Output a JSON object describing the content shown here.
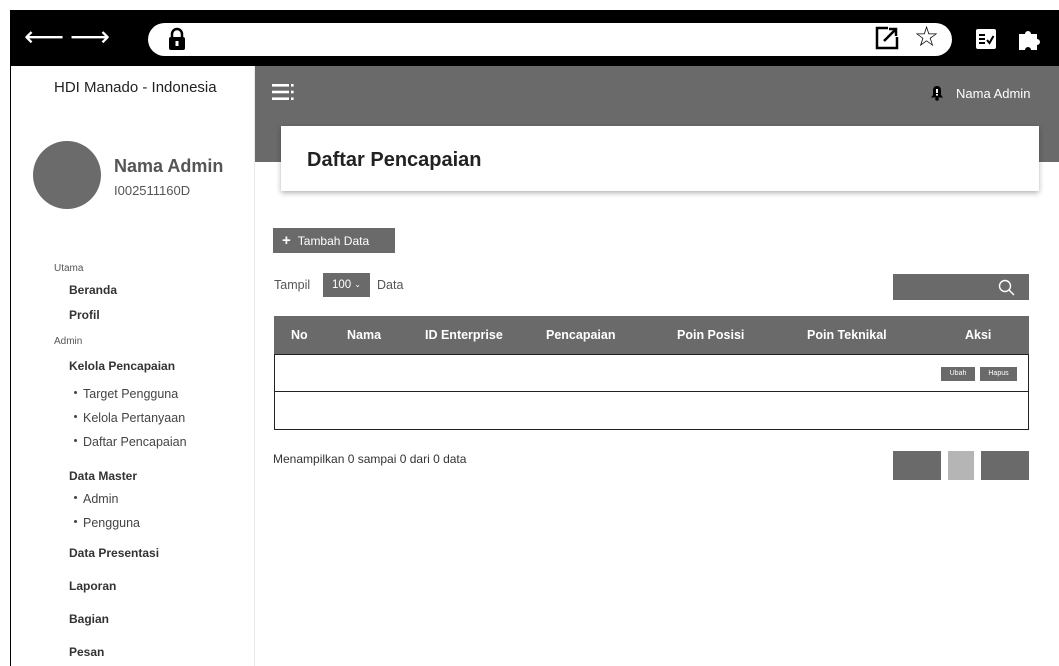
{
  "brand": "HDI Manado - Indonesia",
  "profile": {
    "name": "Nama Admin",
    "id": "I002511160D"
  },
  "menu": {
    "section_main": "Utama",
    "beranda": "Beranda",
    "profil": "Profil",
    "section_admin": "Admin",
    "kelola_pencapaian": "Kelola Pencapaian",
    "sub_target": "Target Pengguna",
    "sub_pertanyaan": "Kelola Pertanyaan",
    "sub_daftar": "Daftar Pencapaian",
    "data_master": "Data Master",
    "sub_admin": "Admin",
    "sub_pengguna": "Pengguna",
    "data_presentasi": "Data Presentasi",
    "laporan": "Laporan",
    "bagian": "Bagian",
    "pesan": "Pesan"
  },
  "header": {
    "admin_name": "Nama Admin"
  },
  "page": {
    "title": "Daftar Pencapaian"
  },
  "toolbar": {
    "add_label": "Tambah Data",
    "show_label": "Tampil",
    "show_value": "100",
    "data_label": "Data"
  },
  "table": {
    "columns": [
      "No",
      "Nama",
      "ID Enterprise",
      "Pencapaian",
      "Poin Posisi",
      "Poin Teknikal",
      "Aksi"
    ],
    "edit_label": "Ubah",
    "delete_label": "Hapus"
  },
  "summary": "Menampilkan 0 sampai 0 dari 0 data",
  "colors": {
    "accent_gray": "#6a6a6a",
    "chrome": "#000000",
    "pager_mid": "#b5b5b5"
  },
  "icons": [
    "back-arrow-icon",
    "forward-arrow-icon",
    "reload-icon",
    "lock-icon",
    "open-external-icon",
    "star-icon",
    "reader-icon",
    "puzzle-icon",
    "hamburger-icon",
    "bell-icon",
    "search-icon",
    "plus-icon",
    "chevron-down-icon"
  ]
}
